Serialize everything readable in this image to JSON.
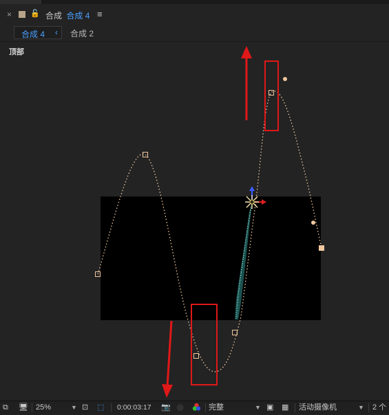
{
  "header": {
    "close": "×",
    "lock": "🔓",
    "prefix": "合成",
    "active_comp": "合成 4",
    "menu": "≡"
  },
  "tabs": [
    {
      "label": "合成 4",
      "active": true
    },
    {
      "label": "合成 2",
      "active": false
    }
  ],
  "viewer": {
    "view_label": "顶部"
  },
  "toolbar": {
    "zoom": "25%",
    "timecode": "0:00:03:17",
    "resolution": "完整",
    "camera": "活动摄像机",
    "views": "2 个"
  },
  "colors": {
    "panel_bg": "#232323",
    "comp_bg": "#000000",
    "motion_path": "#f0c8a0",
    "annotation": "#e01818",
    "active_tab": "#4aa0ff",
    "particles": "#6fd8d0"
  }
}
